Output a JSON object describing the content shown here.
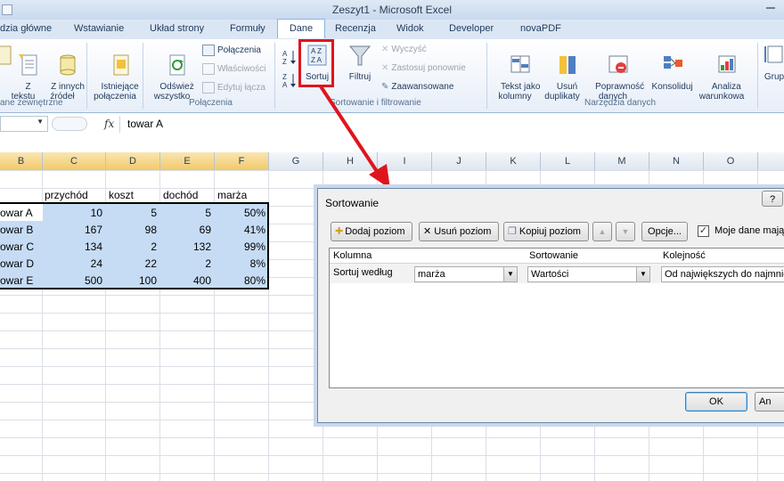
{
  "window": {
    "title": "Zeszyt1 - Microsoft Excel"
  },
  "tabs": [
    "dzia główne",
    "Wstawianie",
    "Układ strony",
    "Formuły",
    "Dane",
    "Recenzja",
    "Widok",
    "Developer",
    "novaPDF"
  ],
  "active_tab": "Dane",
  "ribbon": {
    "ext_data": {
      "btn1": "Z\ntekstu",
      "btn2": "Z innych\nźródeł",
      "btn0": "",
      "label": "ane zewnętrzne"
    },
    "connections": {
      "existing": "Istniejące\npołączenia",
      "refresh": "Odśwież\nwszystko",
      "conn": "Połączenia",
      "props": "Właściwości",
      "edit": "Edytuj łącza",
      "label": "Połączenia"
    },
    "sort": {
      "sort_btn": "Sortuj",
      "filter": "Filtruj",
      "clear": "Wyczyść",
      "reapply": "Zastosuj ponownie",
      "advanced": "Zaawansowane",
      "label": "Sortowanie i filtrowanie"
    },
    "tools": {
      "text_cols": "Tekst jako\nkolumny",
      "dup": "Usuń\nduplikaty",
      "valid": "Poprawność\ndanych",
      "consol": "Konsoliduj",
      "whatif": "Analiza\nwarunkowa",
      "group": "Grup",
      "label": "Narzędzia danych"
    }
  },
  "formula_bar": {
    "fx": "fx",
    "value": "towar A"
  },
  "columns": [
    "B",
    "C",
    "D",
    "E",
    "F",
    "G",
    "H",
    "I",
    "J",
    "K",
    "L",
    "M",
    "N",
    "O"
  ],
  "headers": {
    "c": "przychód",
    "d": "koszt",
    "e": "dochód",
    "f": "marża"
  },
  "rows": [
    {
      "b": "owar A",
      "c": "10",
      "d": "5",
      "e": "5",
      "f": "50%"
    },
    {
      "b": "owar B",
      "c": "167",
      "d": "98",
      "e": "69",
      "f": "41%"
    },
    {
      "b": "owar C",
      "c": "134",
      "d": "2",
      "e": "132",
      "f": "99%"
    },
    {
      "b": "owar D",
      "c": "24",
      "d": "22",
      "e": "2",
      "f": "8%"
    },
    {
      "b": "owar E",
      "c": "500",
      "d": "100",
      "e": "400",
      "f": "80%"
    }
  ],
  "dialog": {
    "title": "Sortowanie",
    "help": "?",
    "add_level": "Dodaj poziom",
    "delete_level": "Usuń poziom",
    "copy_level": "Kopiuj poziom",
    "options": "Opcje...",
    "headers_check": "Moje dane mają n",
    "col_header": "Kolumna",
    "sorton_header": "Sortowanie",
    "order_header": "Kolejność",
    "sort_by_label": "Sortuj według",
    "sort_by_value": "marża",
    "sort_on_value": "Wartości",
    "order_value": "Od największych do najmniejs",
    "ok": "OK",
    "cancel": "An"
  },
  "colors": {
    "accent_red": "#e0141e",
    "selection_fill": "#c6dcf5"
  }
}
